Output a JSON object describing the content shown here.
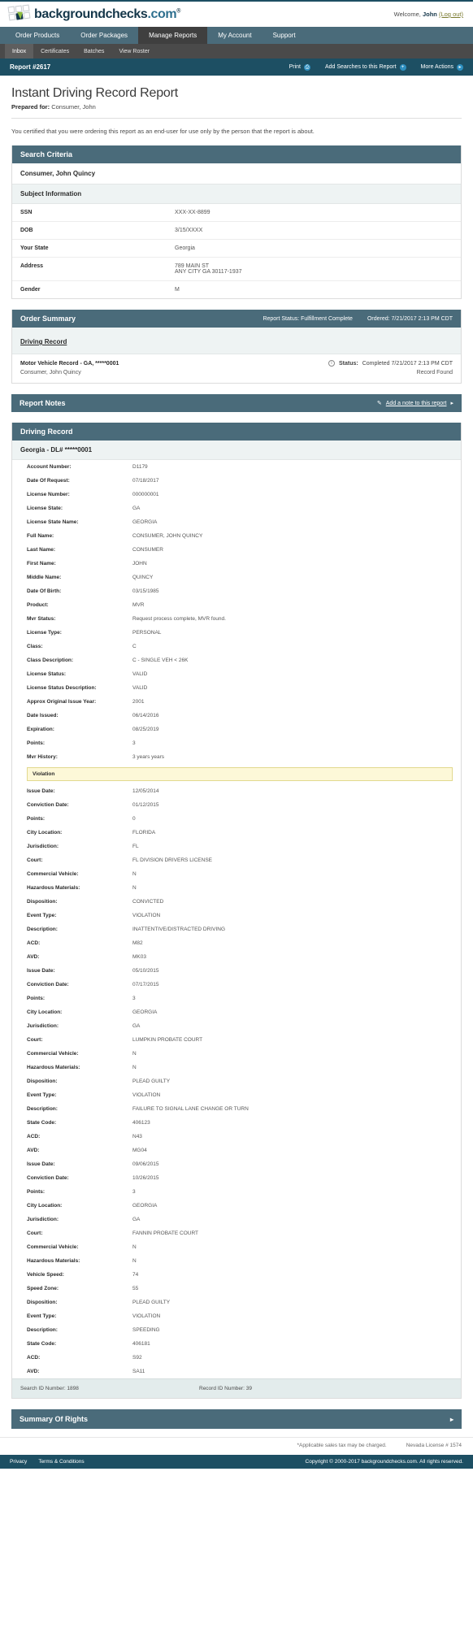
{
  "brand": {
    "name": "backgroundchecks",
    "tld": ".com",
    "trademark": "®",
    "welcome_prefix": "Welcome,",
    "welcome_user": "John",
    "logout_label": "(Log out)"
  },
  "mainnav": [
    {
      "label": "Order Products",
      "active": false
    },
    {
      "label": "Order Packages",
      "active": false
    },
    {
      "label": "Manage Reports",
      "active": true
    },
    {
      "label": "My Account",
      "active": false
    },
    {
      "label": "Support",
      "active": false
    }
  ],
  "subnav": [
    {
      "label": "Inbox",
      "active": true
    },
    {
      "label": "Certificates",
      "active": false
    },
    {
      "label": "Batches",
      "active": false
    },
    {
      "label": "View Roster",
      "active": false
    }
  ],
  "reportbar": {
    "title": "Report #2617",
    "print_label": "Print",
    "add_searches_label": "Add Searches to this Report",
    "more_actions_label": "More Actions"
  },
  "header": {
    "title": "Instant Driving Record Report",
    "prepared_label": "Prepared for:",
    "prepared_name": "Consumer, John",
    "certification": "You certified that you were ordering this report as an end-user for use only by the person that the report is about."
  },
  "search_criteria": {
    "title": "Search Criteria",
    "name": "Consumer, John Quincy",
    "subject_title": "Subject Information",
    "fields": [
      {
        "label": "SSN",
        "value": "XXX-XX-8899"
      },
      {
        "label": "DOB",
        "value": "3/15/XXXX"
      },
      {
        "label": "Your State",
        "value": "Georgia"
      },
      {
        "label": "Address",
        "value": "789 MAIN ST\nANY CITY GA 30117-1937"
      },
      {
        "label": "Gender",
        "value": "M"
      }
    ]
  },
  "order_summary": {
    "title": "Order Summary",
    "report_status": "Report Status: Fulfillment Complete",
    "ordered": "Ordered: 7/21/2017 2:13 PM CDT",
    "section_link": "Driving Record",
    "product_line": "Motor Vehicle Record - GA, *****0001",
    "status_label": "Status:",
    "status_value": "Completed 7/21/2017 2:13 PM CDT",
    "subject_line": "Consumer, John Quincy",
    "result": "Record Found"
  },
  "report_notes": {
    "title": "Report Notes",
    "add_note_label": "Add a note to this report"
  },
  "driving_record": {
    "title": "Driving Record",
    "state_line": "Georgia - DL# *****0001",
    "fields": [
      {
        "label": "Account Number:",
        "value": "D1179"
      },
      {
        "label": "Date Of Request:",
        "value": "07/18/2017"
      },
      {
        "label": "License Number:",
        "value": "000000001"
      },
      {
        "label": "License State:",
        "value": "GA"
      },
      {
        "label": "License State Name:",
        "value": "GEORGIA"
      },
      {
        "label": "Full Name:",
        "value": "CONSUMER, JOHN QUINCY"
      },
      {
        "label": "Last Name:",
        "value": "CONSUMER"
      },
      {
        "label": "First Name:",
        "value": "JOHN"
      },
      {
        "label": "Middle Name:",
        "value": "QUINCY"
      },
      {
        "label": "Date Of Birth:",
        "value": "03/15/1985"
      },
      {
        "label": "Product:",
        "value": "MVR"
      },
      {
        "label": "Mvr Status:",
        "value": "Request process complete, MVR found."
      },
      {
        "label": "License Type:",
        "value": "PERSONAL"
      },
      {
        "label": "Class:",
        "value": "C"
      },
      {
        "label": "Class Description:",
        "value": "C - SINGLE VEH < 26K"
      },
      {
        "label": "License Status:",
        "value": "VALID"
      },
      {
        "label": "License Status Description:",
        "value": "VALID"
      },
      {
        "label": "Approx Original Issue Year:",
        "value": "2001"
      },
      {
        "label": "Date Issued:",
        "value": "06/14/2016"
      },
      {
        "label": "Expiration:",
        "value": "08/25/2019"
      },
      {
        "label": "Points:",
        "value": "3"
      },
      {
        "label": "Mvr History:",
        "value": "3 years years"
      }
    ],
    "violation_banner": "Violation",
    "violation_fields": [
      {
        "label": "Issue Date:",
        "value": "12/05/2014"
      },
      {
        "label": "Conviction Date:",
        "value": "01/12/2015"
      },
      {
        "label": "Points:",
        "value": "0"
      },
      {
        "label": "City Location:",
        "value": "FLORIDA"
      },
      {
        "label": "Jurisdiction:",
        "value": "FL"
      },
      {
        "label": "Court:",
        "value": "FL DIVISION DRIVERS LICENSE"
      },
      {
        "label": "Commercial Vehicle:",
        "value": "N"
      },
      {
        "label": "Hazardous Materials:",
        "value": "N"
      },
      {
        "label": "Disposition:",
        "value": "CONVICTED"
      },
      {
        "label": "Event Type:",
        "value": "VIOLATION"
      },
      {
        "label": "Description:",
        "value": "INATTENTIVE/DISTRACTED DRIVING"
      },
      {
        "label": "ACD:",
        "value": "M82"
      },
      {
        "label": "AVD:",
        "value": "MK03"
      },
      {
        "label": "Issue Date:",
        "value": "05/10/2015"
      },
      {
        "label": "Conviction Date:",
        "value": "07/17/2015"
      },
      {
        "label": "Points:",
        "value": "3"
      },
      {
        "label": "City Location:",
        "value": "GEORGIA"
      },
      {
        "label": "Jurisdiction:",
        "value": "GA"
      },
      {
        "label": "Court:",
        "value": "LUMPKIN PROBATE COURT"
      },
      {
        "label": "Commercial Vehicle:",
        "value": "N"
      },
      {
        "label": "Hazardous Materials:",
        "value": "N"
      },
      {
        "label": "Disposition:",
        "value": "PLEAD GUILTY"
      },
      {
        "label": "Event Type:",
        "value": "VIOLATION"
      },
      {
        "label": "Description:",
        "value": "FAILURE TO SIGNAL LANE CHANGE OR TURN"
      },
      {
        "label": "State Code:",
        "value": "406123"
      },
      {
        "label": "ACD:",
        "value": "N43"
      },
      {
        "label": "AVD:",
        "value": "MG04"
      },
      {
        "label": "Issue Date:",
        "value": "09/06/2015"
      },
      {
        "label": "Conviction Date:",
        "value": "10/26/2015"
      },
      {
        "label": "Points:",
        "value": "3"
      },
      {
        "label": "City Location:",
        "value": "GEORGIA"
      },
      {
        "label": "Jurisdiction:",
        "value": "GA"
      },
      {
        "label": "Court:",
        "value": "FANNIN PROBATE COURT"
      },
      {
        "label": "Commercial Vehicle:",
        "value": "N"
      },
      {
        "label": "Hazardous Materials:",
        "value": "N"
      },
      {
        "label": "Vehicle Speed:",
        "value": "74"
      },
      {
        "label": "Speed Zone:",
        "value": "55"
      },
      {
        "label": "Disposition:",
        "value": "PLEAD GUILTY"
      },
      {
        "label": "Event Type:",
        "value": "VIOLATION"
      },
      {
        "label": "Description:",
        "value": "SPEEDING"
      },
      {
        "label": "State Code:",
        "value": "406181"
      },
      {
        "label": "ACD:",
        "value": "S92"
      },
      {
        "label": "AVD:",
        "value": "SA11"
      }
    ],
    "search_id": "Search ID Number: 1898",
    "record_id": "Record ID Number: 39"
  },
  "summary_of_rights": {
    "title": "Summary Of Rights"
  },
  "legal": {
    "sales_tax": "*Applicable sales tax may be charged.",
    "nevada_license": "Nevada License # 1574"
  },
  "footer": {
    "privacy": "Privacy",
    "terms": "Terms & Conditions",
    "copyright": "Copyright © 2000-2017 backgroundchecks.com. All rights reserved."
  },
  "colors": {
    "brand_dark": "#15374a",
    "nav": "#4a6b7a",
    "bar": "#1d4f63",
    "accent": "#2e8fc0",
    "violation": "#fdf8d8"
  }
}
